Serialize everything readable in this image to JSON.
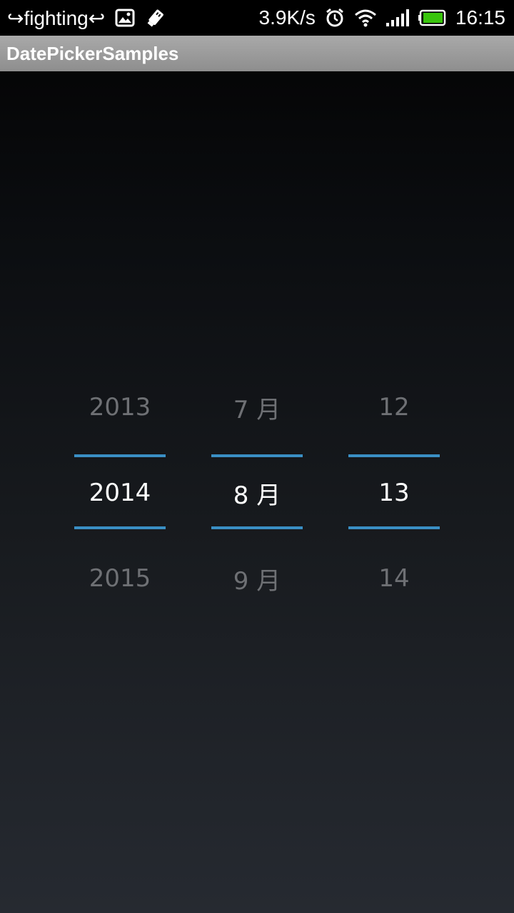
{
  "status_bar": {
    "carrier": "↪fighting↩",
    "network_speed": "3.9K/s",
    "time": "16:15",
    "icons": [
      "image-notification-icon",
      "usb-debug-icon",
      "alarm-icon",
      "wifi-icon",
      "signal-icon",
      "battery-icon"
    ],
    "battery_color": "#39c40d"
  },
  "app_bar": {
    "title": "DatePickerSamples"
  },
  "date_picker": {
    "accent_color": "#3a8fc4",
    "year": {
      "prev": "2013",
      "current": "2014",
      "next": "2015"
    },
    "month": {
      "prev": "7 月",
      "current": "8 月",
      "next": "9 月"
    },
    "day": {
      "prev": "12",
      "current": "13",
      "next": "14"
    }
  }
}
